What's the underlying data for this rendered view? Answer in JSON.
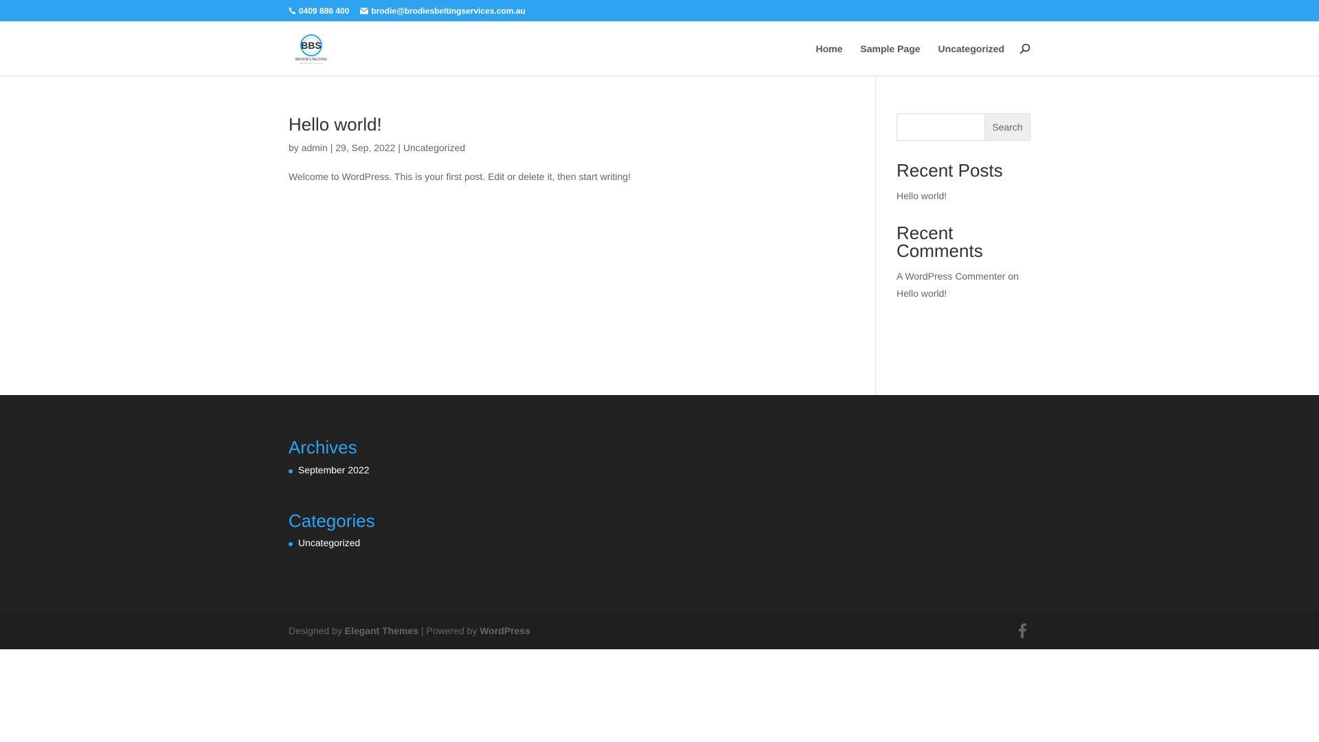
{
  "top_bar": {
    "phone": "0409 886 400",
    "email": "brodie@brodiesbeltingservices.com.au",
    "background": "#2ea3f2"
  },
  "header": {
    "logo_text": "BBS",
    "logo_subtitle": "BRODIE'S BELTING",
    "nav": [
      {
        "label": "Home"
      },
      {
        "label": "Sample Page"
      },
      {
        "label": "Uncategorized"
      }
    ],
    "search_icon": "search-icon"
  },
  "post": {
    "title": "Hello world!",
    "meta": {
      "by": "by",
      "author": "admin",
      "sep1": "|",
      "date": "29, Sep, 2022",
      "sep2": "|",
      "category": "Uncategorized"
    },
    "body": "Welcome to WordPress. This is your first post. Edit or delete it, then start writing!"
  },
  "sidebar": {
    "search": {
      "placeholder": "",
      "button_label": "Search"
    },
    "recent_posts": {
      "title": "Recent Posts",
      "items": [
        "Hello world!"
      ]
    },
    "recent_comments": {
      "title": "Recent Comments",
      "commenter": "A WordPress Commenter",
      "on": "on",
      "post": "Hello world!"
    }
  },
  "footer_widgets": {
    "archives": {
      "title": "Archives",
      "items": [
        "September 2022"
      ]
    },
    "categories": {
      "title": "Categories",
      "items": [
        "Uncategorized"
      ]
    }
  },
  "footer_bottom": {
    "designed_by": "Designed by",
    "theme": "Elegant Themes",
    "separator": "| Powered by",
    "platform": "WordPress",
    "social_icon": "facebook-icon"
  },
  "colors": {
    "accent": "#2ea3f2",
    "footer_bg": "#222222",
    "footer_bottom_bg": "#1f1f1f"
  }
}
